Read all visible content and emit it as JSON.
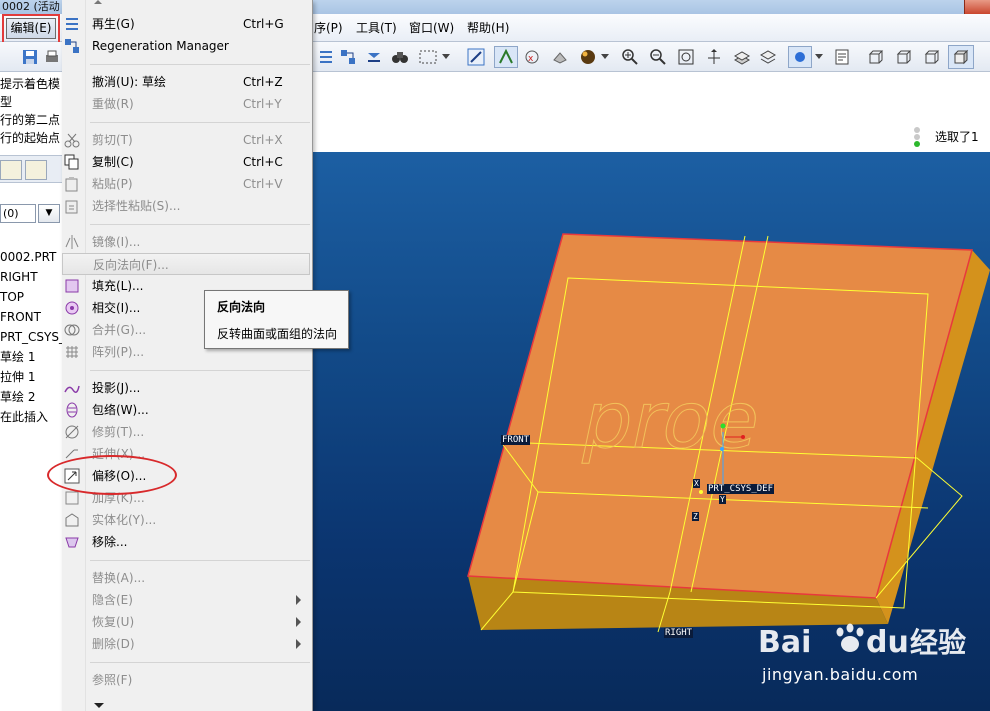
{
  "window": {
    "title": "0002 (活动"
  },
  "menubar": {
    "edit_label": "编辑(E)",
    "items": [
      "序(P)",
      "工具(T)",
      "窗口(W)",
      "帮助(H)"
    ]
  },
  "left_panel": {
    "messages": [
      "提示着色模型",
      "行的第二点",
      "行的起始点"
    ],
    "filter_value": "(0)",
    "tree_items": [
      "0002.PRT",
      "RIGHT",
      "TOP",
      "FRONT",
      "PRT_CSYS_",
      "草绘 1",
      "拉伸 1",
      "草绘 2",
      "在此插入"
    ]
  },
  "status": {
    "selected": "选取了1"
  },
  "edit_menu": {
    "items": [
      {
        "label": "再生(G)",
        "shortcut": "Ctrl+G",
        "icon": "regenerate-icon",
        "enabled": true
      },
      {
        "label": "Regeneration Manager",
        "shortcut": "",
        "icon": "regen-manager-icon",
        "enabled": true
      },
      {
        "label": "撤消(U): 草绘",
        "shortcut": "Ctrl+Z",
        "icon": "",
        "enabled": true
      },
      {
        "label": "重做(R)",
        "shortcut": "Ctrl+Y",
        "icon": "",
        "enabled": false
      },
      {
        "label": "剪切(T)",
        "shortcut": "Ctrl+X",
        "icon": "scissors-icon",
        "enabled": false
      },
      {
        "label": "复制(C)",
        "shortcut": "Ctrl+C",
        "icon": "copy-icon",
        "enabled": true
      },
      {
        "label": "粘贴(P)",
        "shortcut": "Ctrl+V",
        "icon": "paste-icon",
        "enabled": false
      },
      {
        "label": "选择性粘贴(S)...",
        "shortcut": "",
        "icon": "paste-special-icon",
        "enabled": false
      },
      {
        "label": "镜像(I)...",
        "shortcut": "",
        "icon": "mirror-icon",
        "enabled": false
      },
      {
        "label": "反向法向(F)...",
        "shortcut": "",
        "icon": "",
        "enabled": false
      },
      {
        "label": "填充(L)...",
        "shortcut": "",
        "icon": "fill-icon",
        "enabled": true
      },
      {
        "label": "相交(I)...",
        "shortcut": "",
        "icon": "intersect-icon",
        "enabled": true
      },
      {
        "label": "合并(G)...",
        "shortcut": "",
        "icon": "merge-icon",
        "enabled": false
      },
      {
        "label": "阵列(P)...",
        "shortcut": "",
        "icon": "pattern-icon",
        "enabled": false
      },
      {
        "label": "投影(J)...",
        "shortcut": "",
        "icon": "project-icon",
        "enabled": true
      },
      {
        "label": "包络(W)...",
        "shortcut": "",
        "icon": "wrap-icon",
        "enabled": true
      },
      {
        "label": "修剪(T)...",
        "shortcut": "",
        "icon": "trim-icon",
        "enabled": false
      },
      {
        "label": "延伸(X)...",
        "shortcut": "",
        "icon": "extend-icon",
        "enabled": false
      },
      {
        "label": "偏移(O)...",
        "shortcut": "",
        "icon": "offset-icon",
        "enabled": true
      },
      {
        "label": "加厚(K)...",
        "shortcut": "",
        "icon": "thicken-icon",
        "enabled": false
      },
      {
        "label": "实体化(Y)...",
        "shortcut": "",
        "icon": "solidify-icon",
        "enabled": false
      },
      {
        "label": "移除...",
        "shortcut": "",
        "icon": "remove-icon",
        "enabled": true
      },
      {
        "label": "替换(A)...",
        "shortcut": "",
        "icon": "",
        "enabled": false
      },
      {
        "label": "隐含(E)",
        "shortcut": "",
        "icon": "",
        "enabled": false,
        "submenu": true
      },
      {
        "label": "恢复(U)",
        "shortcut": "",
        "icon": "",
        "enabled": false,
        "submenu": true
      },
      {
        "label": "删除(D)",
        "shortcut": "",
        "icon": "",
        "enabled": false,
        "submenu": true
      },
      {
        "label": "参照(F)",
        "shortcut": "",
        "icon": "",
        "enabled": false
      }
    ]
  },
  "tooltip": {
    "title": "反向法向",
    "description": "反转曲面或面组的法向"
  },
  "viewport": {
    "labels": {
      "front": "FRONT",
      "right": "RIGHT",
      "csys": "PRT_CSYS_DEF",
      "csys_x": "X",
      "csys_z": "Z",
      "csys_y": "Y"
    },
    "sketch_text": "proe",
    "colors": {
      "part_top": "#e68a45",
      "part_side": "#d99616",
      "datum": "#ffff33",
      "edge": "#e8383d"
    }
  },
  "watermark": {
    "brand": "Bai",
    "brand2": "du",
    "cn": "经验",
    "url": "jingyan.baidu.com"
  }
}
